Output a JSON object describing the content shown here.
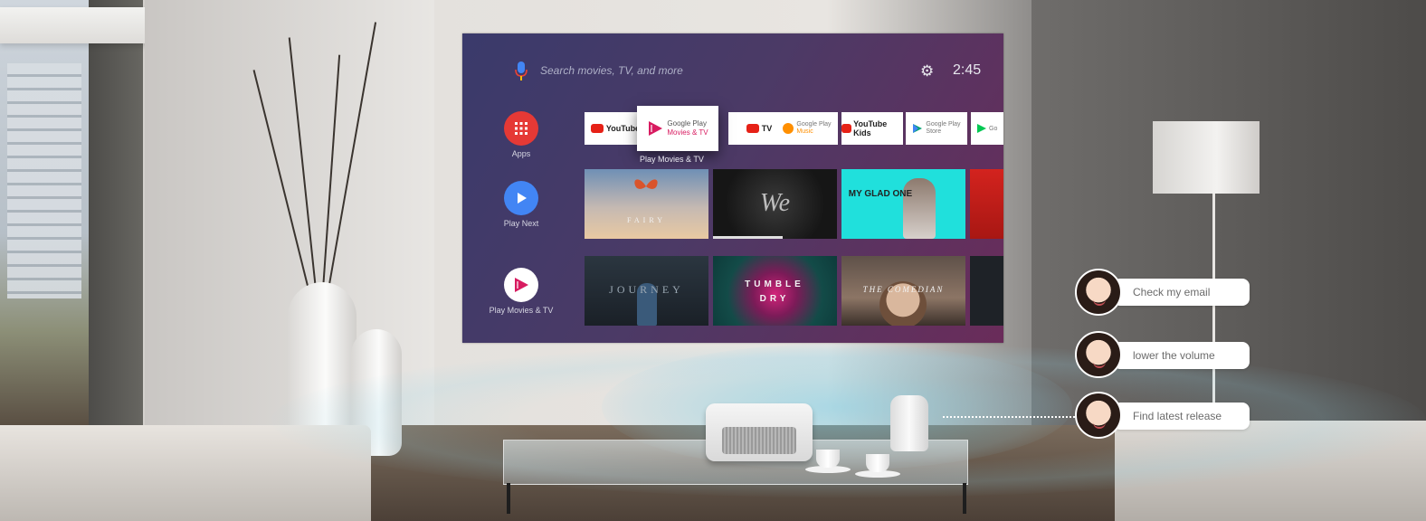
{
  "tv": {
    "search": {
      "placeholder_text": "Search movies, TV, and more",
      "mic_icon": "microphone-icon"
    },
    "settings_icon": "gear-icon",
    "clock": "2:45",
    "nav": [
      {
        "label": "Apps",
        "icon": "grid-icon",
        "color": "#e53935"
      },
      {
        "label": "Play Next",
        "icon": "play-icon",
        "color": "#4285f4"
      },
      {
        "label": "Play Movies & TV",
        "icon": "play-movies-icon",
        "color": "#ffffff"
      }
    ],
    "apps": [
      {
        "label": "YouTube"
      },
      {
        "label": "Google Play",
        "sublabel": "Movies & TV"
      },
      {
        "label": "TV"
      },
      {
        "label": "Google Play",
        "sublabel": "Music"
      },
      {
        "label": "YouTube Kids"
      },
      {
        "label": "Google Play",
        "sublabel": "Store"
      },
      {
        "label": "Go"
      }
    ],
    "focused_app_caption": "Play Movies & TV",
    "row1": [
      {
        "title": "FAIRY"
      },
      {
        "title": "We"
      },
      {
        "title": "MY GLAD ONE"
      },
      {
        "title": ""
      }
    ],
    "row2": [
      {
        "title": "JOURNEY"
      },
      {
        "title": "TUMBLE DRY"
      },
      {
        "title": "THE COMEDIAN"
      },
      {
        "title": ""
      }
    ]
  },
  "voice_commands": [
    {
      "text": "Check my email"
    },
    {
      "text": "lower the volume"
    },
    {
      "text": "Find latest release"
    }
  ]
}
